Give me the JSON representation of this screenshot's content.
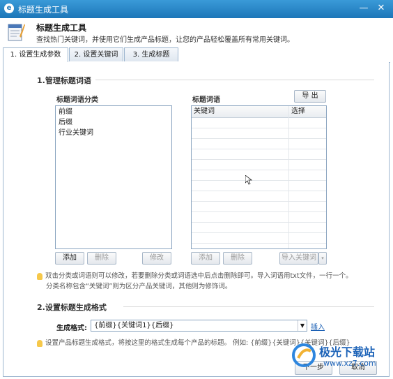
{
  "window": {
    "title": "标题生成工具"
  },
  "header": {
    "title": "标题生成工具",
    "desc": "查找热门关键词，并使用它们生成产品标题，让您的产品轻松覆盖所有常用关键词。"
  },
  "tabs": [
    {
      "label": "1. 设置生成参数"
    },
    {
      "label": "2. 设置关键词"
    },
    {
      "label": "3. 生成标题"
    }
  ],
  "section1": {
    "title": "1.管理标题词语",
    "category_label": "标题词语分类",
    "categories": [
      "前缀",
      "后缀",
      "行业关键词"
    ],
    "words_label": "标题词语",
    "export_label": "导 出",
    "columns": [
      "关键词",
      "选择"
    ],
    "add_label": "添加",
    "delete_label": "删除",
    "modify_label": "修改",
    "add2_label": "添加",
    "delete2_label": "删除",
    "import_label": "导入关键词",
    "hint_line1": "双击分类或词语则可以修改，若要删除分类或词语选中后点击删除即可。导入词语用txt文件，一行一个。",
    "hint_line2": "分类名称包含“关键词”则为区分产品关键词，其他则为修饰词。"
  },
  "section2": {
    "title": "2.设置标题生成格式",
    "format_label": "生成格式:",
    "format_value": "{前缀}{关键词1}{后缀}",
    "insert_label": "插入",
    "hint": "设置产品标题生成格式，将按这里的格式生成每个产品的标题。 例如: {前缀}{关键词}{关键词}{后缀}"
  },
  "footer": {
    "next_label": "下一步",
    "cancel_label": "取消"
  },
  "watermark": {
    "brand": "极光下载站",
    "url": "www.xz7.com"
  }
}
